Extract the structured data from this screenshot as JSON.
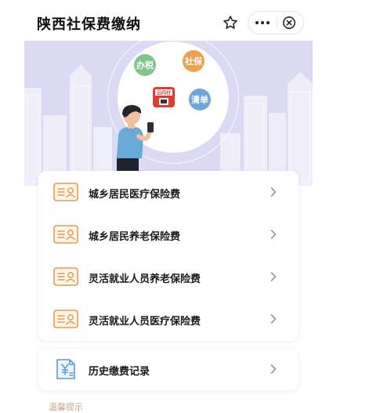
{
  "header": {
    "title": "陕西社保费缴纳",
    "star_icon": "star-icon",
    "more_icon": "more-icon",
    "close_icon": "close-circle-icon"
  },
  "banner": {
    "bubbles": {
      "tax": "办税",
      "social_security": "社保",
      "list": "清单"
    },
    "badge_logo": "云闪付",
    "background_color": "#dcd9f5"
  },
  "services": [
    {
      "label": "城乡居民医疗保险费",
      "icon": "id-card-icon"
    },
    {
      "label": "城乡居民养老保险费",
      "icon": "id-card-icon"
    },
    {
      "label": "灵活就业人员养老保险费",
      "icon": "id-card-icon"
    },
    {
      "label": "灵活就业人员医疗保险费",
      "icon": "id-card-icon"
    }
  ],
  "history": {
    "label": "历史缴费记录",
    "icon": "yuan-document-icon"
  },
  "tip": "温馨提示",
  "colors": {
    "accent_orange": "#e59a4b",
    "accent_blue": "#5b9bd5",
    "chevron": "#999999"
  }
}
